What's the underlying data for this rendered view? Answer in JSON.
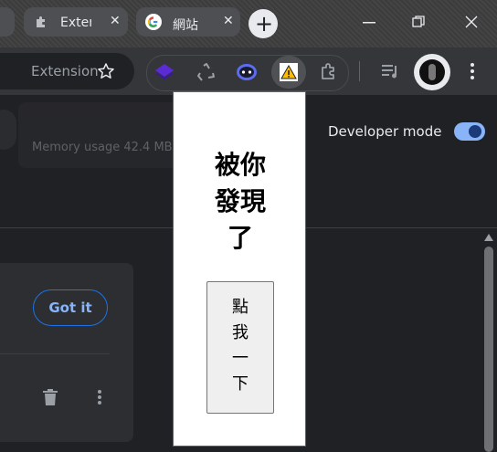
{
  "browser": {
    "tabs": [
      {
        "label": "Exter",
        "icon": "puzzle-icon"
      },
      {
        "label": "網站",
        "icon": "google-icon"
      }
    ],
    "new_tab_label": "+",
    "window_controls": {
      "minimize": "minimize-icon",
      "restore": "restore-icon",
      "close": "close-icon"
    }
  },
  "toolbar": {
    "omnibox_text": "Extension",
    "extensions": [
      "stack-icon",
      "recycle-icon",
      "bot-icon",
      "warning-icon",
      "puzzle-icon"
    ],
    "media_icon": "media-icon",
    "menu_icon": "kebab-icon"
  },
  "page": {
    "memory_text": "Memory usage 42.4 MB",
    "developer_mode_label": "Developer mode",
    "developer_mode_on": true,
    "got_it_label": "Got it"
  },
  "popup": {
    "title_lines": [
      "被你",
      "發現",
      "了"
    ],
    "button_label": "點我一下"
  },
  "colors": {
    "accent": "#8ab4f8",
    "toggle_on": "#8ab4f8",
    "warning": "#fbbc04"
  }
}
